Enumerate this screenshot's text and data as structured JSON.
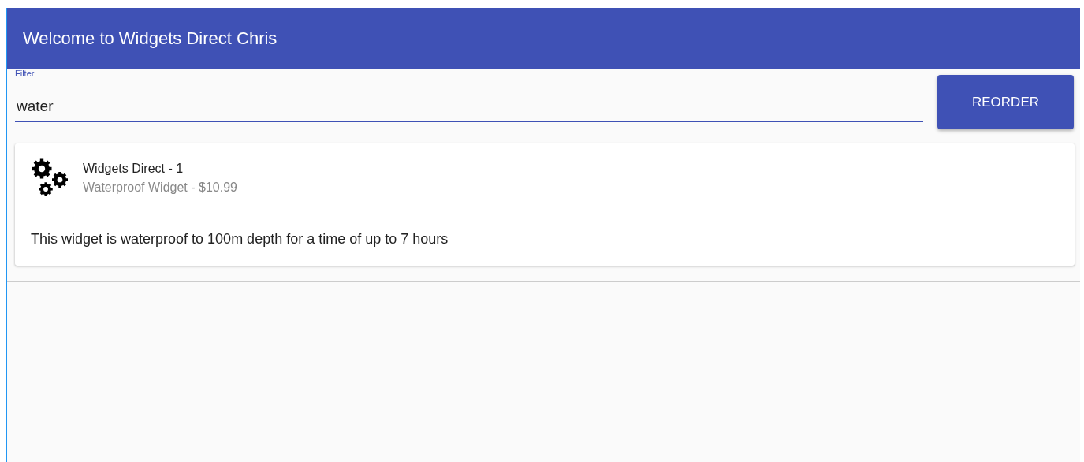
{
  "header": {
    "title": "Welcome to Widgets Direct Chris"
  },
  "filter": {
    "label": "Filter",
    "value": "water"
  },
  "reorder_button": {
    "label": "REORDER"
  },
  "items": [
    {
      "title": "Widgets Direct - 1",
      "subtitle": "Waterproof Widget - $10.99",
      "description": "This widget is waterproof to 100m depth for a time of up to 7 hours"
    }
  ]
}
